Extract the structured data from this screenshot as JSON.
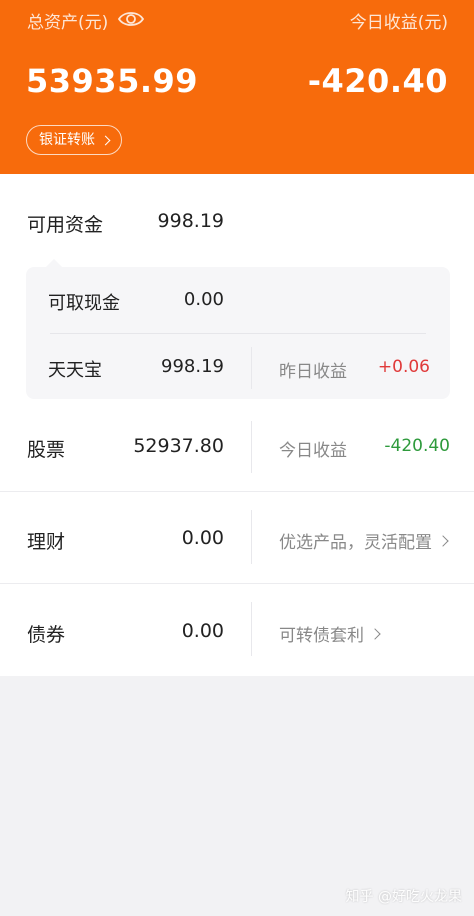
{
  "header": {
    "total_assets_label": "总资产(元)",
    "today_earnings_label": "今日收益(元)",
    "total_assets_value": "53935.99",
    "today_earnings_value": "-420.40",
    "bank_transfer_label": "银证转账",
    "eye_icon": "eye-icon",
    "bg_color": "#f76b0c"
  },
  "funds": {
    "available_label": "可用资金",
    "available_value": "998.19",
    "withdrawable_label": "可取现金",
    "withdrawable_value": "0.00",
    "tiantianbao_label": "天天宝",
    "tiantianbao_value": "998.19",
    "yesterday_label": "昨日收益",
    "yesterday_value": "+0.06"
  },
  "stocks": {
    "label": "股票",
    "value": "52937.80",
    "today_label": "今日收益",
    "today_value": "-420.40"
  },
  "wealth": {
    "label": "理财",
    "value": "0.00",
    "link_text": "优选产品，灵活配置"
  },
  "bonds": {
    "label": "债券",
    "value": "0.00",
    "link_text": "可转债套利"
  },
  "watermark": "知乎 @好吃火龙果",
  "colors": {
    "up": "#e03a3a",
    "down": "#2e9a3c"
  }
}
